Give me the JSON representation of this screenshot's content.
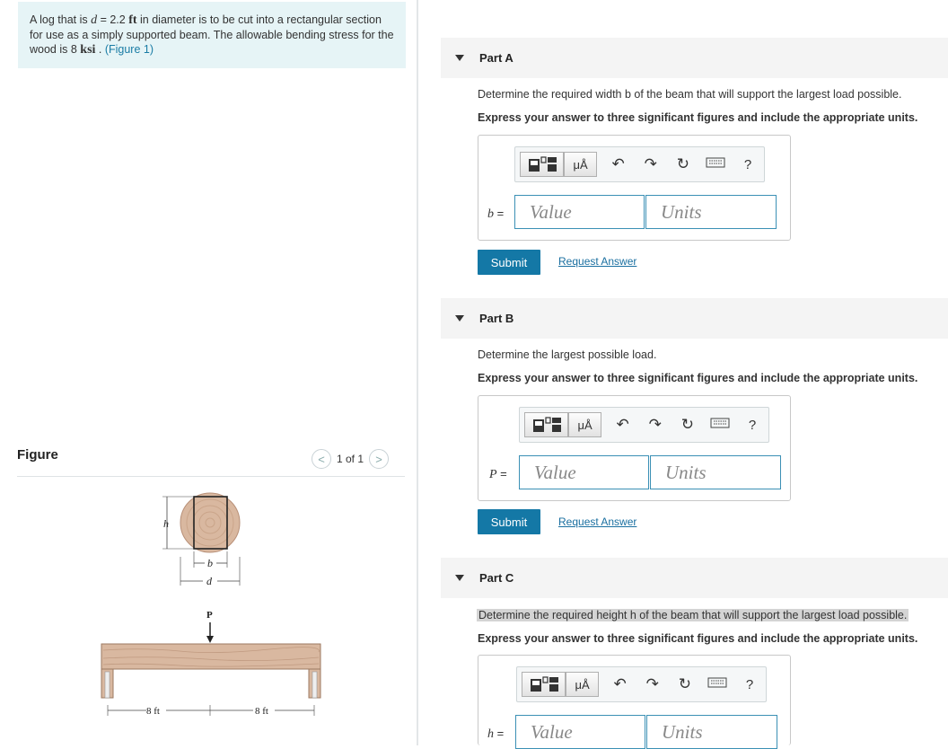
{
  "problem": {
    "p1": "A log that is ",
    "d_var": "d",
    "p2": " = 2.2 ",
    "ft_unit": "ft",
    "p3": " in diameter is to be cut into a rectangular section for use as a simply supported beam. The allowable bending stress for the wood is 8 ",
    "ksi_unit": "ksi",
    "p4": " . ",
    "figure_link": "(Figure 1)"
  },
  "figure": {
    "label": "Figure",
    "prev_icon": "<",
    "pager_text": "1 of 1",
    "next_icon": ">",
    "h_label": "h",
    "b_label": "b",
    "d_label": "d",
    "P_label": "P",
    "span_left": "8 ft",
    "span_right": "8 ft"
  },
  "toolbar": {
    "matrix_icon": "template-icon",
    "units_label": "μÅ",
    "undo": "↶",
    "redo": "↷",
    "reset": "↻",
    "keyboard": "keyboard-icon",
    "help": "?"
  },
  "parts": [
    {
      "title": "Part A",
      "question": "Determine the required width b of the beam that will support the largest load possible.",
      "instruction": "Express your answer to three significant figures and include the appropriate units.",
      "var": "b",
      "eq": " =",
      "value_placeholder": "Value",
      "units_placeholder": "Units",
      "submit": "Submit",
      "request": "Request Answer"
    },
    {
      "title": "Part B",
      "question": "Determine the largest possible load.",
      "instruction": "Express your answer to three significant figures and include the appropriate units.",
      "var": "P",
      "eq": " =",
      "value_placeholder": "Value",
      "units_placeholder": "Units",
      "submit": "Submit",
      "request": "Request Answer"
    },
    {
      "title": "Part C",
      "question": "Determine the required height h of the beam that will support the largest load possible.",
      "instruction": "Express your answer to three significant figures and include the appropriate units.",
      "var": "h",
      "eq": " =",
      "value_placeholder": "Value",
      "units_placeholder": "Units"
    }
  ],
  "colors": {
    "accent": "#1478a6",
    "problem_bg": "#e6f4f6",
    "field_border": "#3b90b5"
  }
}
